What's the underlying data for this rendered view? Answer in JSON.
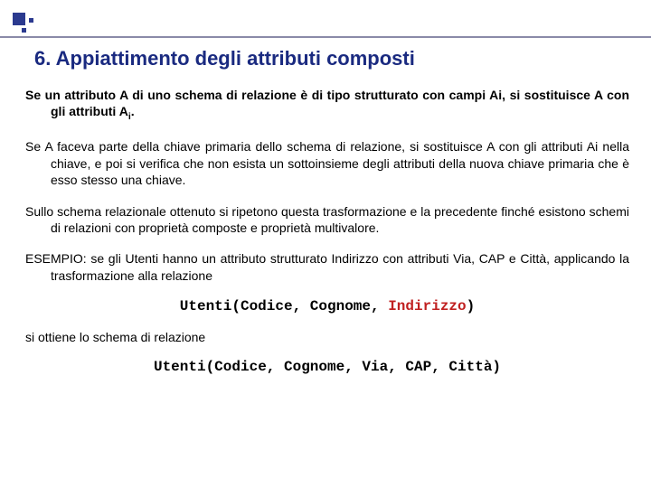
{
  "heading": "6. Appiattimento degli attributi composti",
  "paragraphs": {
    "p1_a": "Se un attributo A di uno schema di relazione è di tipo strutturato con campi Ai, si sostituisce A con gli attributi A",
    "p1_sub": "i",
    "p1_b": ".",
    "p2": "Se A faceva parte della chiave primaria dello schema di relazione, si sostituisce A con gli attributi Ai nella chiave, e poi si verifica che non esista un sottoinsieme degli attributi della nuova chiave primaria che è esso stesso una chiave.",
    "p3": "Sullo schema relazionale ottenuto si ripetono questa trasformazione e la precedente finché esistono schemi di relazioni con proprietà composte e proprietà multivalore.",
    "p4": "ESEMPIO: se gli Utenti hanno un attributo strutturato Indirizzo con attributi Via, CAP e Città, applicando la trasformazione alla relazione"
  },
  "schema1": {
    "prefix": "Utenti(Codice, Cognome, ",
    "highlight": "Indirizzo",
    "suffix": ")"
  },
  "followup": "si ottiene lo schema di relazione",
  "schema2": "Utenti(Codice, Cognome, Via, CAP, Città)"
}
